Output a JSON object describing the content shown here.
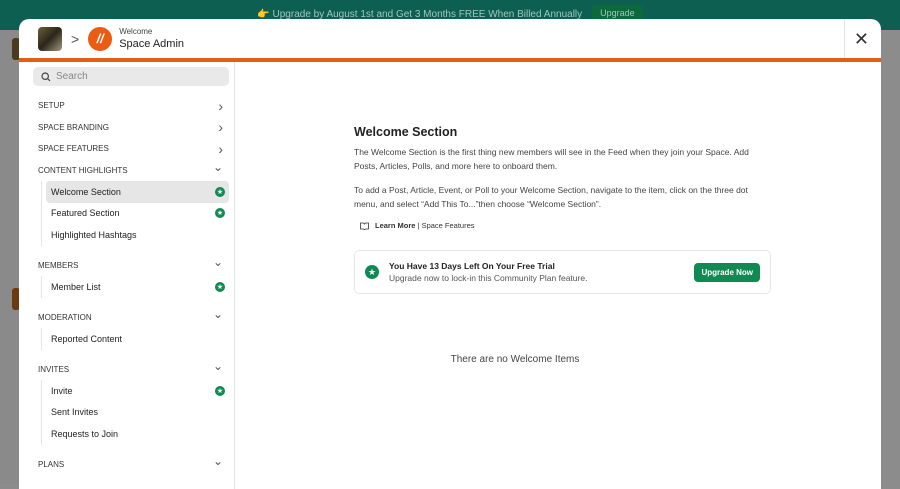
{
  "banner": {
    "text": "👉 Upgrade by August 1st and Get 3 Months FREE When Billed Annually",
    "button": "Upgrade"
  },
  "header": {
    "subtitle": "Welcome",
    "title": "Space Admin",
    "logo_letter": "//",
    "close": "✕"
  },
  "sidebar": {
    "search_placeholder": "Search",
    "sections": [
      {
        "label": "SETUP",
        "expanded": false,
        "items": []
      },
      {
        "label": "SPACE BRANDING",
        "expanded": false,
        "items": []
      },
      {
        "label": "SPACE FEATURES",
        "expanded": false,
        "items": []
      },
      {
        "label": "CONTENT HIGHLIGHTS",
        "expanded": true,
        "items": [
          {
            "label": "Welcome Section",
            "star": true,
            "active": true
          },
          {
            "label": "Featured Section",
            "star": true
          },
          {
            "label": "Highlighted Hashtags",
            "star": false
          }
        ]
      },
      {
        "label": "MEMBERS",
        "expanded": true,
        "items": [
          {
            "label": "Member List",
            "star": true
          }
        ]
      },
      {
        "label": "MODERATION",
        "expanded": true,
        "items": [
          {
            "label": "Reported Content",
            "star": false
          }
        ]
      },
      {
        "label": "INVITES",
        "expanded": true,
        "items": [
          {
            "label": "Invite",
            "star": true
          },
          {
            "label": "Sent Invites",
            "star": false
          },
          {
            "label": "Requests to Join",
            "star": false
          }
        ]
      },
      {
        "label": "PLANS",
        "expanded": true,
        "items": []
      }
    ]
  },
  "main": {
    "title": "Welcome Section",
    "para1": "The Welcome Section is the first thing new members will see in the Feed when they join your Space. Add Posts, Articles, Polls, and more here to onboard them.",
    "para2": "To add a Post, Article, Event, or Poll to your Welcome Section, navigate to the item, click on the three dot menu, and select “Add This To...”then choose “Welcome Section”.",
    "learn_more": "Learn More",
    "learn_sep": "| Space Features",
    "trial_title": "You Have 13 Days Left On Your Free Trial",
    "trial_sub": "Upgrade now to lock-in this Community Plan feature.",
    "upgrade_button": "Upgrade Now",
    "empty": "There are no Welcome Items"
  },
  "colors": {
    "accent": "#e35d13",
    "green": "#108a52"
  }
}
